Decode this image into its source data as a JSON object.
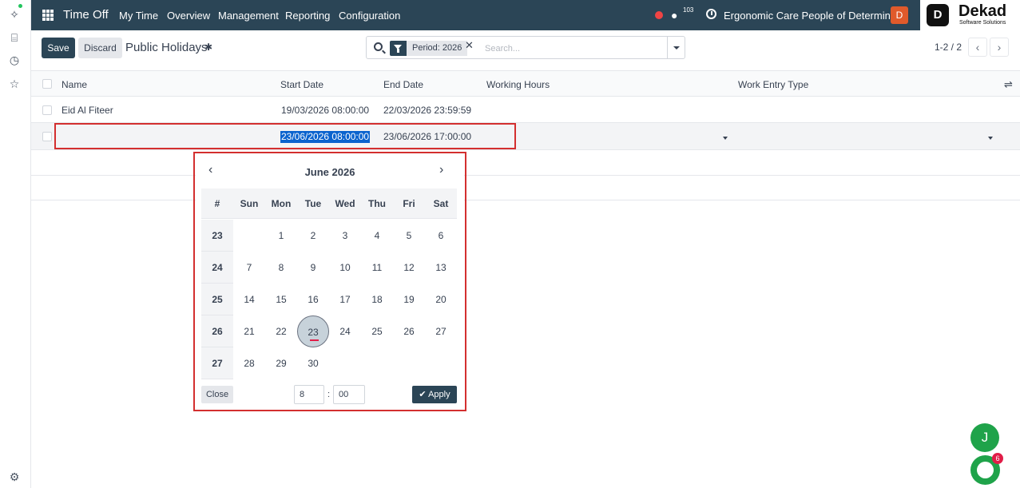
{
  "nav": {
    "app_title": "Time Off",
    "menu": [
      "My Time",
      "Overview",
      "Management",
      "Reporting",
      "Configuration"
    ],
    "chat_count": "103",
    "company": "Ergonomic Care People of Determina...",
    "user_initial": "D",
    "brand_name": "Dekad",
    "brand_tagline": "Software Solutions",
    "brand_logo_letter": "D"
  },
  "control": {
    "save_label": "Save",
    "discard_label": "Discard",
    "title": "Public Holidays",
    "search_facet": "Period: 2026",
    "search_placeholder": "Search...",
    "pager": "1-2 / 2"
  },
  "list": {
    "columns": [
      "Name",
      "Start Date",
      "End Date",
      "Working Hours",
      "Work Entry Type"
    ],
    "rows": [
      {
        "name": "Eid Al Fiteer",
        "start": "19/03/2026 08:00:00",
        "end": "22/03/2026 23:59:59"
      },
      {
        "name": "",
        "start": "23/06/2026 08:00:00",
        "end": "23/06/2026 17:00:00"
      }
    ]
  },
  "datepicker": {
    "month_label": "June 2026",
    "week_header": "#",
    "days_of_week": [
      "Sun",
      "Mon",
      "Tue",
      "Wed",
      "Thu",
      "Fri",
      "Sat"
    ],
    "weeks": [
      {
        "num": "23",
        "days": [
          "",
          "1",
          "2",
          "3",
          "4",
          "5",
          "6"
        ]
      },
      {
        "num": "24",
        "days": [
          "7",
          "8",
          "9",
          "10",
          "11",
          "12",
          "13"
        ]
      },
      {
        "num": "25",
        "days": [
          "14",
          "15",
          "16",
          "17",
          "18",
          "19",
          "20"
        ]
      },
      {
        "num": "26",
        "days": [
          "21",
          "22",
          "23",
          "24",
          "25",
          "26",
          "27"
        ]
      },
      {
        "num": "27",
        "days": [
          "28",
          "29",
          "30",
          "",
          "",
          "",
          ""
        ]
      }
    ],
    "selected_day": "23",
    "close_label": "Close",
    "hour": "8",
    "time_sep": ":",
    "minute": "00",
    "apply_label": "Apply"
  },
  "floating": {
    "assistant_initial": "J",
    "people_badge": "6"
  },
  "colors": {
    "navbar": "#2b4556",
    "highlight": "#0b63ce",
    "annotation": "#d32f2f",
    "fab": "#1fa34a"
  },
  "icons": [
    "sparkle-icon",
    "building-icon",
    "clock-icon",
    "star-icon",
    "settings-icon",
    "apps-grid-icon",
    "chat-icon",
    "gear-icon",
    "search-icon",
    "filter-icon",
    "close-icon",
    "chevron-left-icon",
    "chevron-right-icon",
    "column-options-icon",
    "checkmark-icon",
    "people-icon"
  ]
}
